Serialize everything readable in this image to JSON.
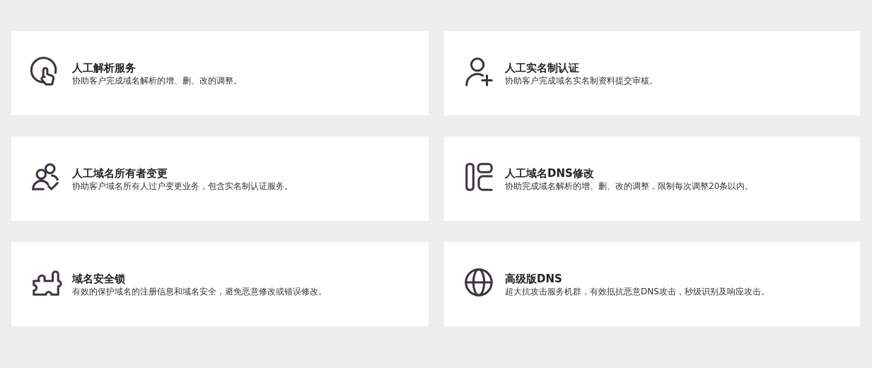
{
  "services": [
    {
      "title": "人工解析服务",
      "description": "协助客户完成域名解析的增、删、改的调整。"
    },
    {
      "title": "人工实名制认证",
      "description": "协助客户完成域名实名制资料提交审核。"
    },
    {
      "title": "人工域名所有者变更",
      "description": "协助客户域名所有人过户变更业务，包含实名制认证服务。"
    },
    {
      "title": "人工域名DNS修改",
      "description": "协助完成域名解析的增、删、改的调整，限制每次调整20条以内。"
    },
    {
      "title": "域名安全锁",
      "description": "有效的保护域名的注册信息和域名安全，避免恶意修改或错误修改。"
    },
    {
      "title": "高级版DNS",
      "description": "超大抗攻击服务机群，有效抵抗恶意DNS攻击，秒级识别及响应攻击。"
    }
  ]
}
